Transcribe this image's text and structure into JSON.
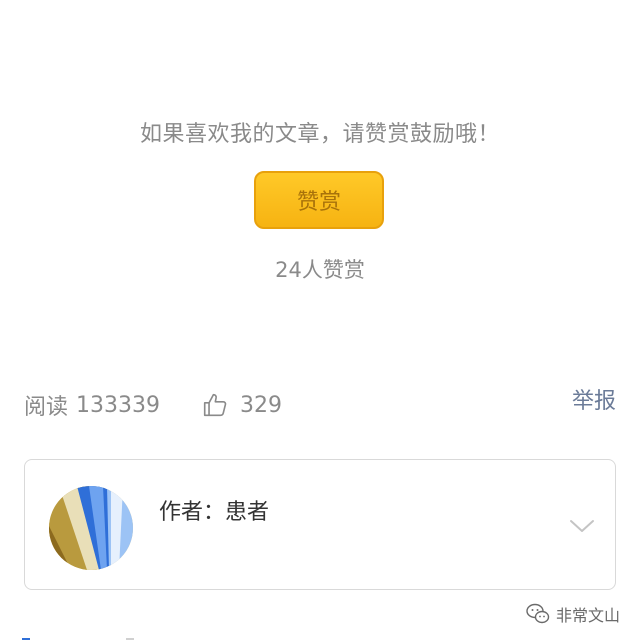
{
  "reward": {
    "prompt": "如果喜欢我的文章，请赞赏鼓励哦！",
    "button_label": "赞赏",
    "count_text": "24人赞赏"
  },
  "stats": {
    "read_label": "阅读",
    "read_count": "133339",
    "like_icon": "thumbs-up-icon",
    "like_count": "329",
    "report_label": "举报"
  },
  "author": {
    "label": "作者：",
    "name": "患者",
    "expand_icon": "chevron-down-icon"
  },
  "watermark": {
    "icon": "wechat-icon",
    "text": "非常文山"
  },
  "colors": {
    "button_fill": "#f6b312",
    "button_border": "#e8a10c",
    "button_text": "#a8720a",
    "muted_text": "#8a8a8a",
    "link_text": "#6b7b98"
  }
}
